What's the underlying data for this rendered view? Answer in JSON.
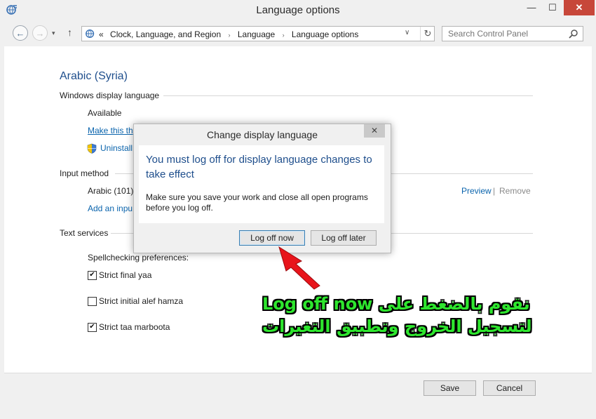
{
  "window": {
    "title": "Language options",
    "minimize": "—",
    "maximize": "☐",
    "close": "✕"
  },
  "navbar": {
    "back": "←",
    "forward": "→",
    "history": "▾",
    "up": "↑",
    "prefix": "«",
    "breadcrumb": [
      "Clock, Language, and Region",
      "Language",
      "Language options"
    ],
    "separator": "›",
    "dropdown": "∨",
    "refresh": "↻",
    "search_placeholder": "Search Control Panel"
  },
  "content": {
    "heading": "Arabic (Syria)",
    "display_language": {
      "label": "Windows display language",
      "status": "Available",
      "make_primary_link": "Make this th",
      "uninstall_link": "Uninstall"
    },
    "input_method": {
      "label": "Input method",
      "item": "Arabic (101)",
      "preview_link": "Preview",
      "divider": "|",
      "remove_link": "Remove",
      "add_link": "Add an inpu"
    },
    "text_services": {
      "label": "Text services",
      "spellcheck_label": "Spellchecking preferences:",
      "options": [
        {
          "label": "Strict final yaa",
          "checked": true
        },
        {
          "label": "Strict initial alef hamza",
          "checked": false
        },
        {
          "label": "Strict taa marboota",
          "checked": true
        }
      ]
    }
  },
  "footer": {
    "save": "Save",
    "cancel": "Cancel"
  },
  "dialog": {
    "title": "Change display language",
    "close": "✕",
    "main_text": "You must log off for display language changes to take effect",
    "sub_text": "Make sure you save your work and close all open programs before you log off.",
    "log_off_now": "Log off now",
    "log_off_later": "Log off later"
  },
  "annotation": {
    "line1": "نقوم بالضغط على Log off now",
    "line2": "لتسجيل الخروج وتطبيق التغيرات",
    "color": "#2ee62e",
    "arrow_color": "#e8141b"
  },
  "colors": {
    "accent": "#1e4e8c",
    "link": "#0a64ad",
    "close_button": "#c7473a"
  }
}
